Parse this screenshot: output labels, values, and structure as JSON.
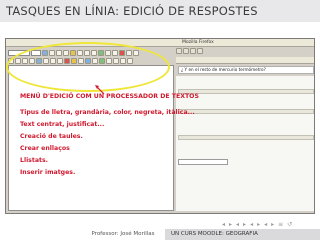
{
  "slide": {
    "title": "TASQUES EN LÍNIA: EDICIÓ DE RESPOSTES"
  },
  "screenshot": {
    "window_title": "Mozilla Firefox",
    "question_text": "¿ Y en el resto de mercurio termómetro?"
  },
  "callout": {
    "heading": "MENÚ D'EDICIÓ COM UN PROCESSADOR DE TEXTOS",
    "items": [
      "Tipus de lletra, grandària, color, negreta, itàlica...",
      "Text centrat, justificat...",
      "Creació de taules.",
      "Crear enllaços",
      "Llistats.",
      "Inserir imatges."
    ]
  },
  "footer": {
    "author": "Professor: José Morillas",
    "course": "UN CURS MOODLE: GEOGRAFIA"
  },
  "nav": {
    "icons": [
      "◂",
      "▸",
      "◂",
      "▸",
      "◂",
      "▸",
      "◂",
      "▸",
      "≡",
      "↺"
    ]
  },
  "colors": {
    "title_bg": "#e8e8ea",
    "highlight": "#f0e63a",
    "callout_text": "#d0192e",
    "footer_bar": "#dadadd"
  }
}
